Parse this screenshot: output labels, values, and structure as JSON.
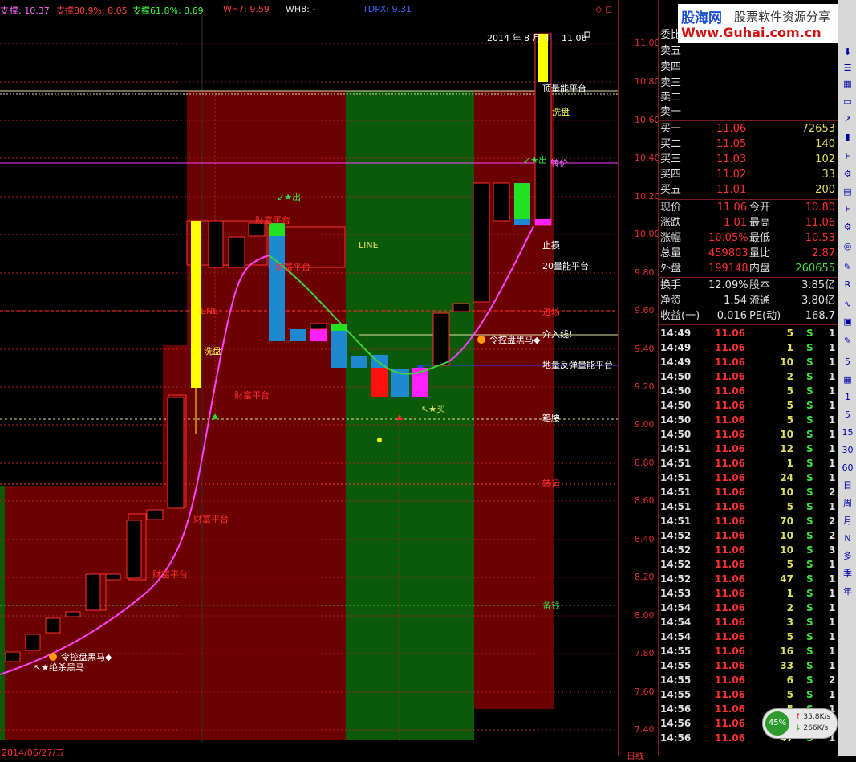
{
  "indicators": {
    "trunc": "支",
    "v0": "撑: 10.37",
    "s80": "支撑80.9%: 8.05",
    "s61": "支撑61.8%: 8.69",
    "wh7": "WH7: 9.59",
    "wh8": "WH8: -",
    "tdpx": "TDPX: 9.31",
    "icons": "◇ ◻"
  },
  "chart_labels": {
    "date": "2014 年 8 月 4",
    "price_flag": "11.06",
    "line": "LINE",
    "out1": "↙★出",
    "out2": "↙★出",
    "buy": "↖★买",
    "wealth": [
      "财富平台",
      "财富平台",
      "财富平台",
      "财富平台",
      "财富平台"
    ],
    "ene": "ENE",
    "dip1": "洗盘",
    "dip2": "洗盘",
    "black_horse_1": "令控盘黑马◆",
    "black_horse_2": "↖★绝杀黑马",
    "black_horse_3": "令控盘黑马◆",
    "vol_top": "顶量能平台",
    "stop": "止损",
    "vol20": "20量能平台",
    "entry": "进场",
    "cut_line": "介入线!",
    "low_vol": "地量反弹量能平台",
    "box_waist": "箱腰",
    "turn": "转运",
    "turn_price": "转价",
    "spare": "备钱",
    "bottom_date": "2014/06/27/五",
    "axis_trunc": "日线"
  },
  "axis_ticks": [
    "11.00",
    "10.80",
    "10.60",
    "10.40",
    "10.20",
    "10.00",
    "9.80",
    "9.60",
    "9.40",
    "9.20",
    "9.00",
    "8.80",
    "8.60",
    "8.40",
    "8.20",
    "8.00",
    "7.80",
    "7.60",
    "7.40"
  ],
  "watermark": {
    "brand": "股海网",
    "slogan": "股票软件资源分享",
    "url": "Www.Guhai.com.cn"
  },
  "order_book": {
    "header": "委比",
    "sells": [
      {
        "label": "卖五",
        "price": "",
        "vol": ""
      },
      {
        "label": "卖四",
        "price": "",
        "vol": ""
      },
      {
        "label": "卖三",
        "price": "",
        "vol": ""
      },
      {
        "label": "卖二",
        "price": "",
        "vol": ""
      },
      {
        "label": "卖一",
        "price": "",
        "vol": ""
      }
    ],
    "buys": [
      {
        "label": "买一",
        "price": "11.06",
        "vol": "72653"
      },
      {
        "label": "买二",
        "price": "11.05",
        "vol": "140"
      },
      {
        "label": "买三",
        "price": "11.03",
        "vol": "102"
      },
      {
        "label": "买四",
        "price": "11.02",
        "vol": "33"
      },
      {
        "label": "买五",
        "price": "11.01",
        "vol": "200"
      }
    ]
  },
  "quote": [
    {
      "l1": "现价",
      "v1": "11.06",
      "l2": "今开",
      "v2": "10.80"
    },
    {
      "l1": "涨跌",
      "v1": "1.01",
      "l2": "最高",
      "v2": "11.06"
    },
    {
      "l1": "涨幅",
      "v1": "10.05%",
      "l2": "最低",
      "v2": "10.53"
    },
    {
      "l1": "总量",
      "v1": "459803",
      "l2": "量比",
      "v2": "2.87"
    },
    {
      "l1": "外盘",
      "v1": "199148",
      "l2": "内盘",
      "v2": "260655"
    }
  ],
  "fundamentals": [
    {
      "l1": "换手",
      "v1": "12.09%",
      "l2": "股本",
      "v2": "3.85亿"
    },
    {
      "l1": "净资",
      "v1": "1.54",
      "l2": "流通",
      "v2": "3.80亿"
    },
    {
      "l1": "收益(一)",
      "v1": "0.016",
      "l2": "PE(动)",
      "v2": "168.7"
    }
  ],
  "ticks": [
    [
      "14:49",
      "11.06",
      "5",
      "S",
      "1"
    ],
    [
      "14:49",
      "11.06",
      "1",
      "S",
      "1"
    ],
    [
      "14:49",
      "11.06",
      "10",
      "S",
      "1"
    ],
    [
      "14:50",
      "11.06",
      "2",
      "S",
      "1"
    ],
    [
      "14:50",
      "11.06",
      "5",
      "S",
      "1"
    ],
    [
      "14:50",
      "11.06",
      "5",
      "S",
      "1"
    ],
    [
      "14:50",
      "11.06",
      "5",
      "S",
      "1"
    ],
    [
      "14:50",
      "11.06",
      "10",
      "S",
      "1"
    ],
    [
      "14:51",
      "11.06",
      "12",
      "S",
      "1"
    ],
    [
      "14:51",
      "11.06",
      "1",
      "S",
      "1"
    ],
    [
      "14:51",
      "11.06",
      "24",
      "S",
      "1"
    ],
    [
      "14:51",
      "11.06",
      "10",
      "S",
      "2"
    ],
    [
      "14:51",
      "11.06",
      "5",
      "S",
      "1"
    ],
    [
      "14:51",
      "11.06",
      "70",
      "S",
      "2"
    ],
    [
      "14:52",
      "11.06",
      "10",
      "S",
      "2"
    ],
    [
      "14:52",
      "11.06",
      "10",
      "S",
      "3"
    ],
    [
      "14:52",
      "11.06",
      "5",
      "S",
      "1"
    ],
    [
      "14:52",
      "11.06",
      "47",
      "S",
      "1"
    ],
    [
      "14:53",
      "11.06",
      "1",
      "S",
      "1"
    ],
    [
      "14:54",
      "11.06",
      "2",
      "S",
      "1"
    ],
    [
      "14:54",
      "11.06",
      "3",
      "S",
      "1"
    ],
    [
      "14:54",
      "11.06",
      "5",
      "S",
      "1"
    ],
    [
      "14:55",
      "11.06",
      "16",
      "S",
      "1"
    ],
    [
      "14:55",
      "11.06",
      "33",
      "S",
      "1"
    ],
    [
      "14:55",
      "11.06",
      "6",
      "S",
      "2"
    ],
    [
      "14:55",
      "11.06",
      "5",
      "S",
      "1"
    ],
    [
      "14:56",
      "11.06",
      "5",
      "S",
      "1"
    ],
    [
      "14:56",
      "11.06",
      "1",
      "S",
      "1"
    ],
    [
      "14:56",
      "11.06",
      "47",
      "S",
      "1"
    ]
  ],
  "toolbar": [
    "1",
    "5",
    "15",
    "30",
    "60",
    "日",
    "周",
    "月",
    "N",
    "多",
    "季",
    "年"
  ],
  "net": {
    "pct": "45%",
    "up": "35.8K/s",
    "down": "266K/s"
  }
}
